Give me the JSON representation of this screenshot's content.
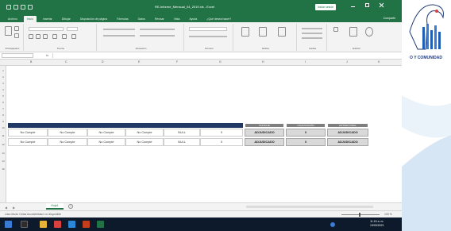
{
  "window": {
    "title": "RE-Informe_Mensual_04_2019.xls - Excel",
    "user_button": "Iniciar sesión"
  },
  "ribbon": {
    "tabs": [
      "Archivo",
      "Inicio",
      "Insertar",
      "Dibujar",
      "Disposición de página",
      "Fórmulas",
      "Datos",
      "Revisar",
      "Vista",
      "Ayuda",
      "¿Qué desea hacer?"
    ],
    "active_tab": "Inicio",
    "share_label": "Compartir",
    "groups": [
      "Portapapeles",
      "Fuente",
      "Alineación",
      "Número",
      "Estilos",
      "Celdas",
      "Edición"
    ]
  },
  "formula_bar": {
    "fx_label": "fx"
  },
  "sheet": {
    "columns": [
      "B",
      "C",
      "D",
      "E",
      "F",
      "G",
      "H",
      "I",
      "J",
      "K",
      "L"
    ],
    "rows": [
      "1",
      "2",
      "3",
      "4",
      "5",
      "6",
      "7",
      "8",
      "9",
      "10",
      "11",
      "12",
      "13",
      "14",
      "15"
    ],
    "header_row": [
      "PUNTAJE",
      "CALIFICACIÓN",
      "ESTADO FINAL"
    ],
    "data_rows": [
      {
        "cells": [
          "No Cumple",
          "No Cumple",
          "No Cumple",
          "No Cumple",
          "NULL",
          "0"
        ],
        "score": "ADJUDICADO",
        "rating": "0",
        "status": "ADJUDICADO"
      },
      {
        "cells": [
          "No Cumple",
          "No Cumple",
          "No Cumple",
          "No Cumple",
          "NULL",
          "0"
        ],
        "score": "ADJUDICADO",
        "rating": "0",
        "status": "ADJUDICADO"
      }
    ]
  },
  "sheet_tabs": {
    "active": "Hoja1",
    "add_label": "+"
  },
  "status_bar": {
    "text": "Listo   Modo Celda   Accesibilidad: no disponible",
    "zoom": "100 %"
  },
  "taskbar": {
    "time": "11:15 a. m.",
    "date": "13/03/2021"
  },
  "brand": {
    "text": "O Y COMUNIDAD",
    "colors": {
      "primary": "#217346",
      "accent": "#1f3864",
      "brand": "#1f3b7a"
    }
  }
}
